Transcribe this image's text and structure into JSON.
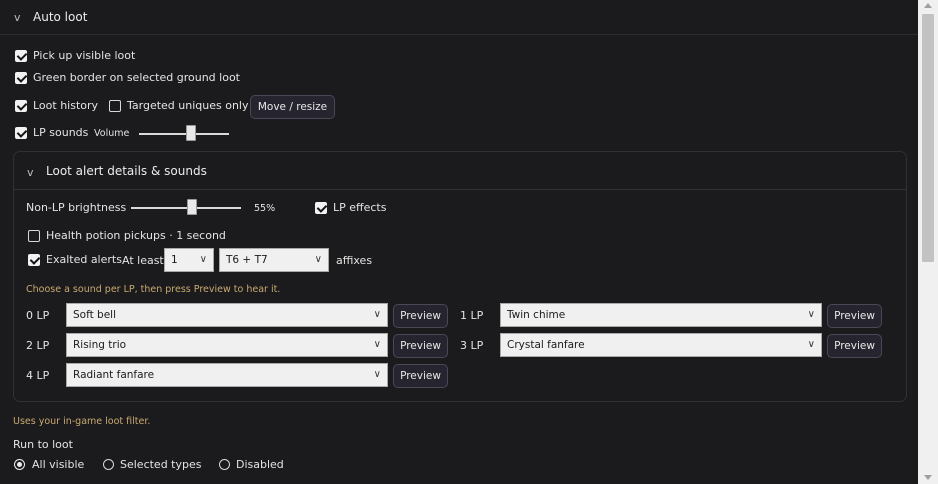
{
  "section": {
    "title": "Auto loot",
    "chevron_icon": "chevron-down-icon"
  },
  "options": {
    "pick_up_visible_loot": {
      "label": "Pick up visible loot",
      "checked": true
    },
    "green_border": {
      "label": "Green border on selected ground loot",
      "checked": true
    },
    "loot_history": {
      "label": "Loot history",
      "checked": true
    },
    "targeted_uniques_only": {
      "label": "Targeted uniques only",
      "checked": false
    },
    "move_resize_button": "Move / resize",
    "lp_sounds": {
      "label": "LP sounds",
      "checked": true
    },
    "volume_label": "Volume",
    "volume_level": 0.58
  },
  "alert_section": {
    "title": "Loot alert details & sounds",
    "brightness_label": "Non-LP brightness",
    "brightness_value": "55%",
    "brightness_level": 0.55,
    "lp_effects": {
      "label": "LP effects",
      "checked": true
    },
    "health_potion": {
      "label": "Health potion pickups · 1 second",
      "checked": false
    },
    "exalted_alerts": {
      "label": "Exalted alerts",
      "checked": true
    },
    "at_least_label": "At least",
    "at_least_value": "1",
    "tier_value": "T6 + T7",
    "affixes_label": "affixes",
    "hint": "Choose a sound per LP, then press Preview to hear it.",
    "preview_label": "Preview",
    "sounds": [
      {
        "lp": "0 LP",
        "sound": "Soft bell"
      },
      {
        "lp": "1 LP",
        "sound": "Twin chime"
      },
      {
        "lp": "2 LP",
        "sound": "Rising trio"
      },
      {
        "lp": "3 LP",
        "sound": "Crystal fanfare"
      },
      {
        "lp": "4 LP",
        "sound": "Radiant fanfare"
      }
    ]
  },
  "footer": {
    "filter_note": "Uses your in-game loot filter.",
    "run_to_loot_label": "Run to loot",
    "radio_options": [
      {
        "label": "All visible",
        "selected": true
      },
      {
        "label": "Selected types",
        "selected": false
      },
      {
        "label": "Disabled",
        "selected": false
      }
    ]
  }
}
